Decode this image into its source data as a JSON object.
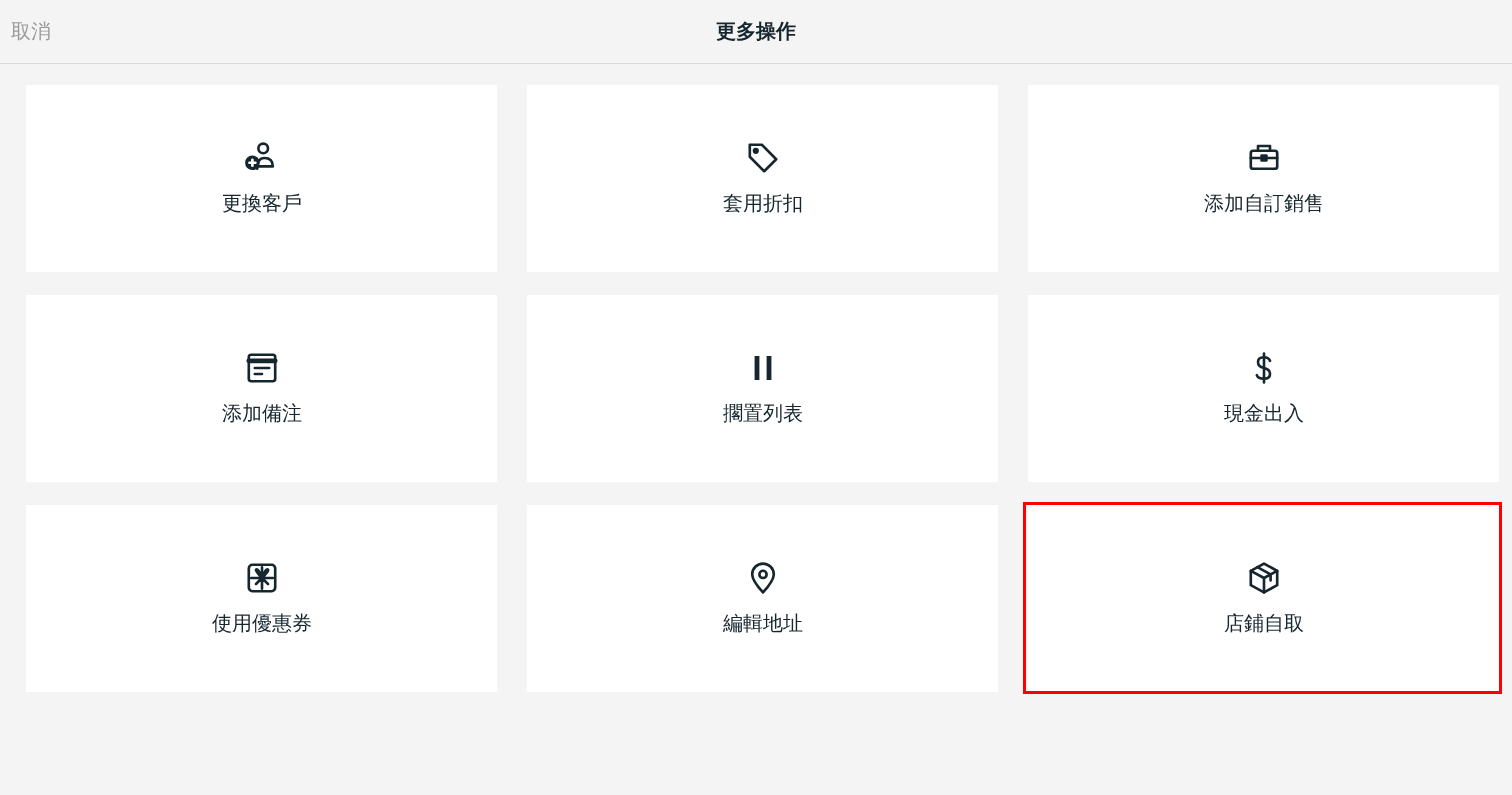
{
  "header": {
    "cancel": "取消",
    "title": "更多操作"
  },
  "actions": [
    {
      "label": "更換客戶",
      "highlighted": false
    },
    {
      "label": "套用折扣",
      "highlighted": false
    },
    {
      "label": "添加自訂銷售",
      "highlighted": false
    },
    {
      "label": "添加備注",
      "highlighted": false
    },
    {
      "label": "擱置列表",
      "highlighted": false
    },
    {
      "label": "現金出入",
      "highlighted": false
    },
    {
      "label": "使用優惠券",
      "highlighted": false
    },
    {
      "label": "編輯地址",
      "highlighted": false
    },
    {
      "label": "店鋪自取",
      "highlighted": true
    }
  ]
}
